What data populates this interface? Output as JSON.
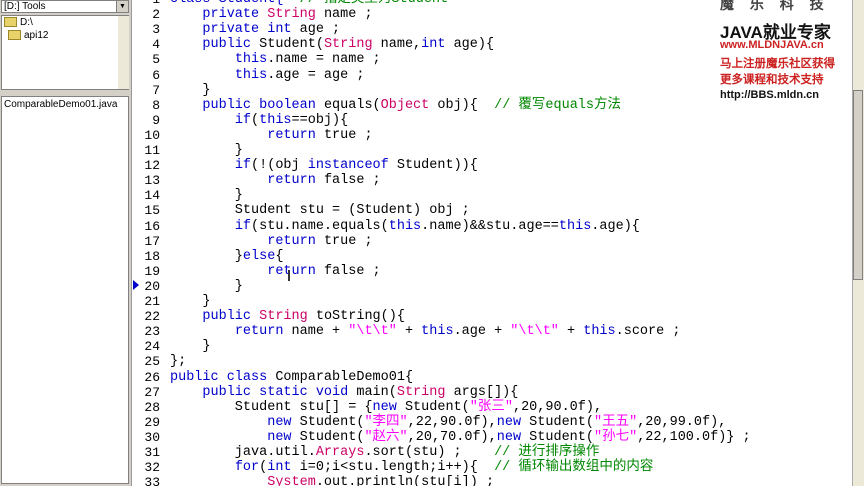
{
  "left_panel": {
    "drive_select": "[D:] Tools",
    "tree": [
      "D:\\",
      "api12"
    ],
    "files": [
      "ComparableDemo01.java"
    ]
  },
  "banner": {
    "line1": "魔 乐 科 技",
    "line2": "JAVA就业专家",
    "line3": "www.MLDNJAVA.cn",
    "line4": "马上注册魔乐社区获得",
    "line5": "更多课程和技术支持",
    "line6": "http://BBS.mldn.cn"
  },
  "code_lines": [
    {
      "n": "1",
      "segs": [
        {
          "t": "class Student{  ",
          "c": "k"
        },
        {
          "t": "// 指定类型为Student",
          "c": "c"
        }
      ]
    },
    {
      "n": "2",
      "segs": [
        {
          "t": "    ",
          "c": ""
        },
        {
          "t": "private ",
          "c": "k"
        },
        {
          "t": "String ",
          "c": "t"
        },
        {
          "t": "name ;",
          "c": ""
        }
      ]
    },
    {
      "n": "3",
      "segs": [
        {
          "t": "    ",
          "c": ""
        },
        {
          "t": "private int ",
          "c": "k"
        },
        {
          "t": "age ;",
          "c": ""
        }
      ]
    },
    {
      "n": "4",
      "segs": [
        {
          "t": "    ",
          "c": ""
        },
        {
          "t": "public ",
          "c": "k"
        },
        {
          "t": "Student(",
          "c": ""
        },
        {
          "t": "String ",
          "c": "t"
        },
        {
          "t": "name,",
          "c": ""
        },
        {
          "t": "int ",
          "c": "k"
        },
        {
          "t": "age){",
          "c": ""
        }
      ]
    },
    {
      "n": "5",
      "segs": [
        {
          "t": "        ",
          "c": ""
        },
        {
          "t": "this",
          "c": "k"
        },
        {
          "t": ".name = name ;",
          "c": ""
        }
      ]
    },
    {
      "n": "6",
      "segs": [
        {
          "t": "        ",
          "c": ""
        },
        {
          "t": "this",
          "c": "k"
        },
        {
          "t": ".age = age ;",
          "c": ""
        }
      ]
    },
    {
      "n": "7",
      "segs": [
        {
          "t": "    }",
          "c": ""
        }
      ]
    },
    {
      "n": "8",
      "segs": [
        {
          "t": "    ",
          "c": ""
        },
        {
          "t": "public boolean ",
          "c": "k"
        },
        {
          "t": "equals(",
          "c": ""
        },
        {
          "t": "Object ",
          "c": "t"
        },
        {
          "t": "obj){  ",
          "c": ""
        },
        {
          "t": "// 覆写equals方法",
          "c": "c"
        }
      ]
    },
    {
      "n": "9",
      "segs": [
        {
          "t": "        ",
          "c": ""
        },
        {
          "t": "if",
          "c": "k"
        },
        {
          "t": "(",
          "c": ""
        },
        {
          "t": "this",
          "c": "k"
        },
        {
          "t": "==obj){",
          "c": ""
        }
      ]
    },
    {
      "n": "10",
      "segs": [
        {
          "t": "            ",
          "c": ""
        },
        {
          "t": "return ",
          "c": "k"
        },
        {
          "t": "true ;",
          "c": ""
        }
      ]
    },
    {
      "n": "11",
      "segs": [
        {
          "t": "        }",
          "c": ""
        }
      ]
    },
    {
      "n": "12",
      "segs": [
        {
          "t": "        ",
          "c": ""
        },
        {
          "t": "if",
          "c": "k"
        },
        {
          "t": "(!(obj ",
          "c": ""
        },
        {
          "t": "instanceof ",
          "c": "k"
        },
        {
          "t": "Student)){",
          "c": ""
        }
      ]
    },
    {
      "n": "13",
      "segs": [
        {
          "t": "            ",
          "c": ""
        },
        {
          "t": "return ",
          "c": "k"
        },
        {
          "t": "false ;",
          "c": ""
        }
      ]
    },
    {
      "n": "14",
      "segs": [
        {
          "t": "        }",
          "c": ""
        }
      ]
    },
    {
      "n": "15",
      "segs": [
        {
          "t": "        Student stu = (Student) obj ;",
          "c": ""
        }
      ]
    },
    {
      "n": "16",
      "segs": [
        {
          "t": "        ",
          "c": ""
        },
        {
          "t": "if",
          "c": "k"
        },
        {
          "t": "(stu.name.equals(",
          "c": ""
        },
        {
          "t": "this",
          "c": "k"
        },
        {
          "t": ".name)&&stu.age==",
          "c": ""
        },
        {
          "t": "this",
          "c": "k"
        },
        {
          "t": ".age){",
          "c": ""
        }
      ]
    },
    {
      "n": "17",
      "segs": [
        {
          "t": "            ",
          "c": ""
        },
        {
          "t": "return ",
          "c": "k"
        },
        {
          "t": "true ;",
          "c": ""
        }
      ]
    },
    {
      "n": "18",
      "segs": [
        {
          "t": "        }",
          "c": ""
        },
        {
          "t": "else",
          "c": "k"
        },
        {
          "t": "{",
          "c": ""
        }
      ]
    },
    {
      "n": "19",
      "segs": [
        {
          "t": "            ",
          "c": ""
        },
        {
          "t": "return ",
          "c": "k"
        },
        {
          "t": "false ;",
          "c": ""
        }
      ]
    },
    {
      "n": "20",
      "segs": [
        {
          "t": "        }",
          "c": ""
        }
      ]
    },
    {
      "n": "21",
      "segs": [
        {
          "t": "    }",
          "c": ""
        }
      ]
    },
    {
      "n": "22",
      "segs": [
        {
          "t": "    ",
          "c": ""
        },
        {
          "t": "public ",
          "c": "k"
        },
        {
          "t": "String ",
          "c": "t"
        },
        {
          "t": "toString(){",
          "c": ""
        }
      ]
    },
    {
      "n": "23",
      "segs": [
        {
          "t": "        ",
          "c": ""
        },
        {
          "t": "return ",
          "c": "k"
        },
        {
          "t": "name + ",
          "c": ""
        },
        {
          "t": "\"\\t\\t\"",
          "c": "s"
        },
        {
          "t": " + ",
          "c": ""
        },
        {
          "t": "this",
          "c": "k"
        },
        {
          "t": ".age + ",
          "c": ""
        },
        {
          "t": "\"\\t\\t\"",
          "c": "s"
        },
        {
          "t": " + ",
          "c": ""
        },
        {
          "t": "this",
          "c": "k"
        },
        {
          "t": ".score ;",
          "c": ""
        }
      ]
    },
    {
      "n": "24",
      "segs": [
        {
          "t": "    }",
          "c": ""
        }
      ]
    },
    {
      "n": "25",
      "segs": [
        {
          "t": "};",
          "c": ""
        }
      ]
    },
    {
      "n": "26",
      "segs": [
        {
          "t": "public class ",
          "c": "k"
        },
        {
          "t": "ComparableDemo01{",
          "c": ""
        }
      ]
    },
    {
      "n": "27",
      "segs": [
        {
          "t": "    ",
          "c": ""
        },
        {
          "t": "public static void ",
          "c": "k"
        },
        {
          "t": "main(",
          "c": ""
        },
        {
          "t": "String ",
          "c": "t"
        },
        {
          "t": "args[]){",
          "c": ""
        }
      ]
    },
    {
      "n": "28",
      "segs": [
        {
          "t": "        Student stu[] = {",
          "c": ""
        },
        {
          "t": "new ",
          "c": "k"
        },
        {
          "t": "Student(",
          "c": ""
        },
        {
          "t": "\"张三\"",
          "c": "s"
        },
        {
          "t": ",20,90.0f),",
          "c": ""
        }
      ]
    },
    {
      "n": "29",
      "segs": [
        {
          "t": "            ",
          "c": ""
        },
        {
          "t": "new ",
          "c": "k"
        },
        {
          "t": "Student(",
          "c": ""
        },
        {
          "t": "\"李四\"",
          "c": "s"
        },
        {
          "t": ",22,90.0f),",
          "c": ""
        },
        {
          "t": "new ",
          "c": "k"
        },
        {
          "t": "Student(",
          "c": ""
        },
        {
          "t": "\"王五\"",
          "c": "s"
        },
        {
          "t": ",20,99.0f),",
          "c": ""
        }
      ]
    },
    {
      "n": "30",
      "segs": [
        {
          "t": "            ",
          "c": ""
        },
        {
          "t": "new ",
          "c": "k"
        },
        {
          "t": "Student(",
          "c": ""
        },
        {
          "t": "\"赵六\"",
          "c": "s"
        },
        {
          "t": ",20,70.0f),",
          "c": ""
        },
        {
          "t": "new ",
          "c": "k"
        },
        {
          "t": "Student(",
          "c": ""
        },
        {
          "t": "\"孙七\"",
          "c": "s"
        },
        {
          "t": ",22,100.0f)} ;",
          "c": ""
        }
      ]
    },
    {
      "n": "31",
      "segs": [
        {
          "t": "        java.util.",
          "c": ""
        },
        {
          "t": "Arrays",
          "c": "t"
        },
        {
          "t": ".sort(stu) ;    ",
          "c": ""
        },
        {
          "t": "// 进行排序操作",
          "c": "c"
        }
      ]
    },
    {
      "n": "32",
      "segs": [
        {
          "t": "        ",
          "c": ""
        },
        {
          "t": "for",
          "c": "k"
        },
        {
          "t": "(",
          "c": ""
        },
        {
          "t": "int ",
          "c": "k"
        },
        {
          "t": "i=0;i<stu.length;i++){  ",
          "c": ""
        },
        {
          "t": "// 循环输出数组中的内容",
          "c": "c"
        }
      ]
    },
    {
      "n": "33",
      "segs": [
        {
          "t": "            ",
          "c": ""
        },
        {
          "t": "System",
          "c": "t"
        },
        {
          "t": ".out.println(stu[i]) ;",
          "c": ""
        }
      ]
    }
  ],
  "colors": {
    "keyword": "#0000cc",
    "type": "#cc0066",
    "string": "#ff00ff",
    "comment": "#008800"
  }
}
